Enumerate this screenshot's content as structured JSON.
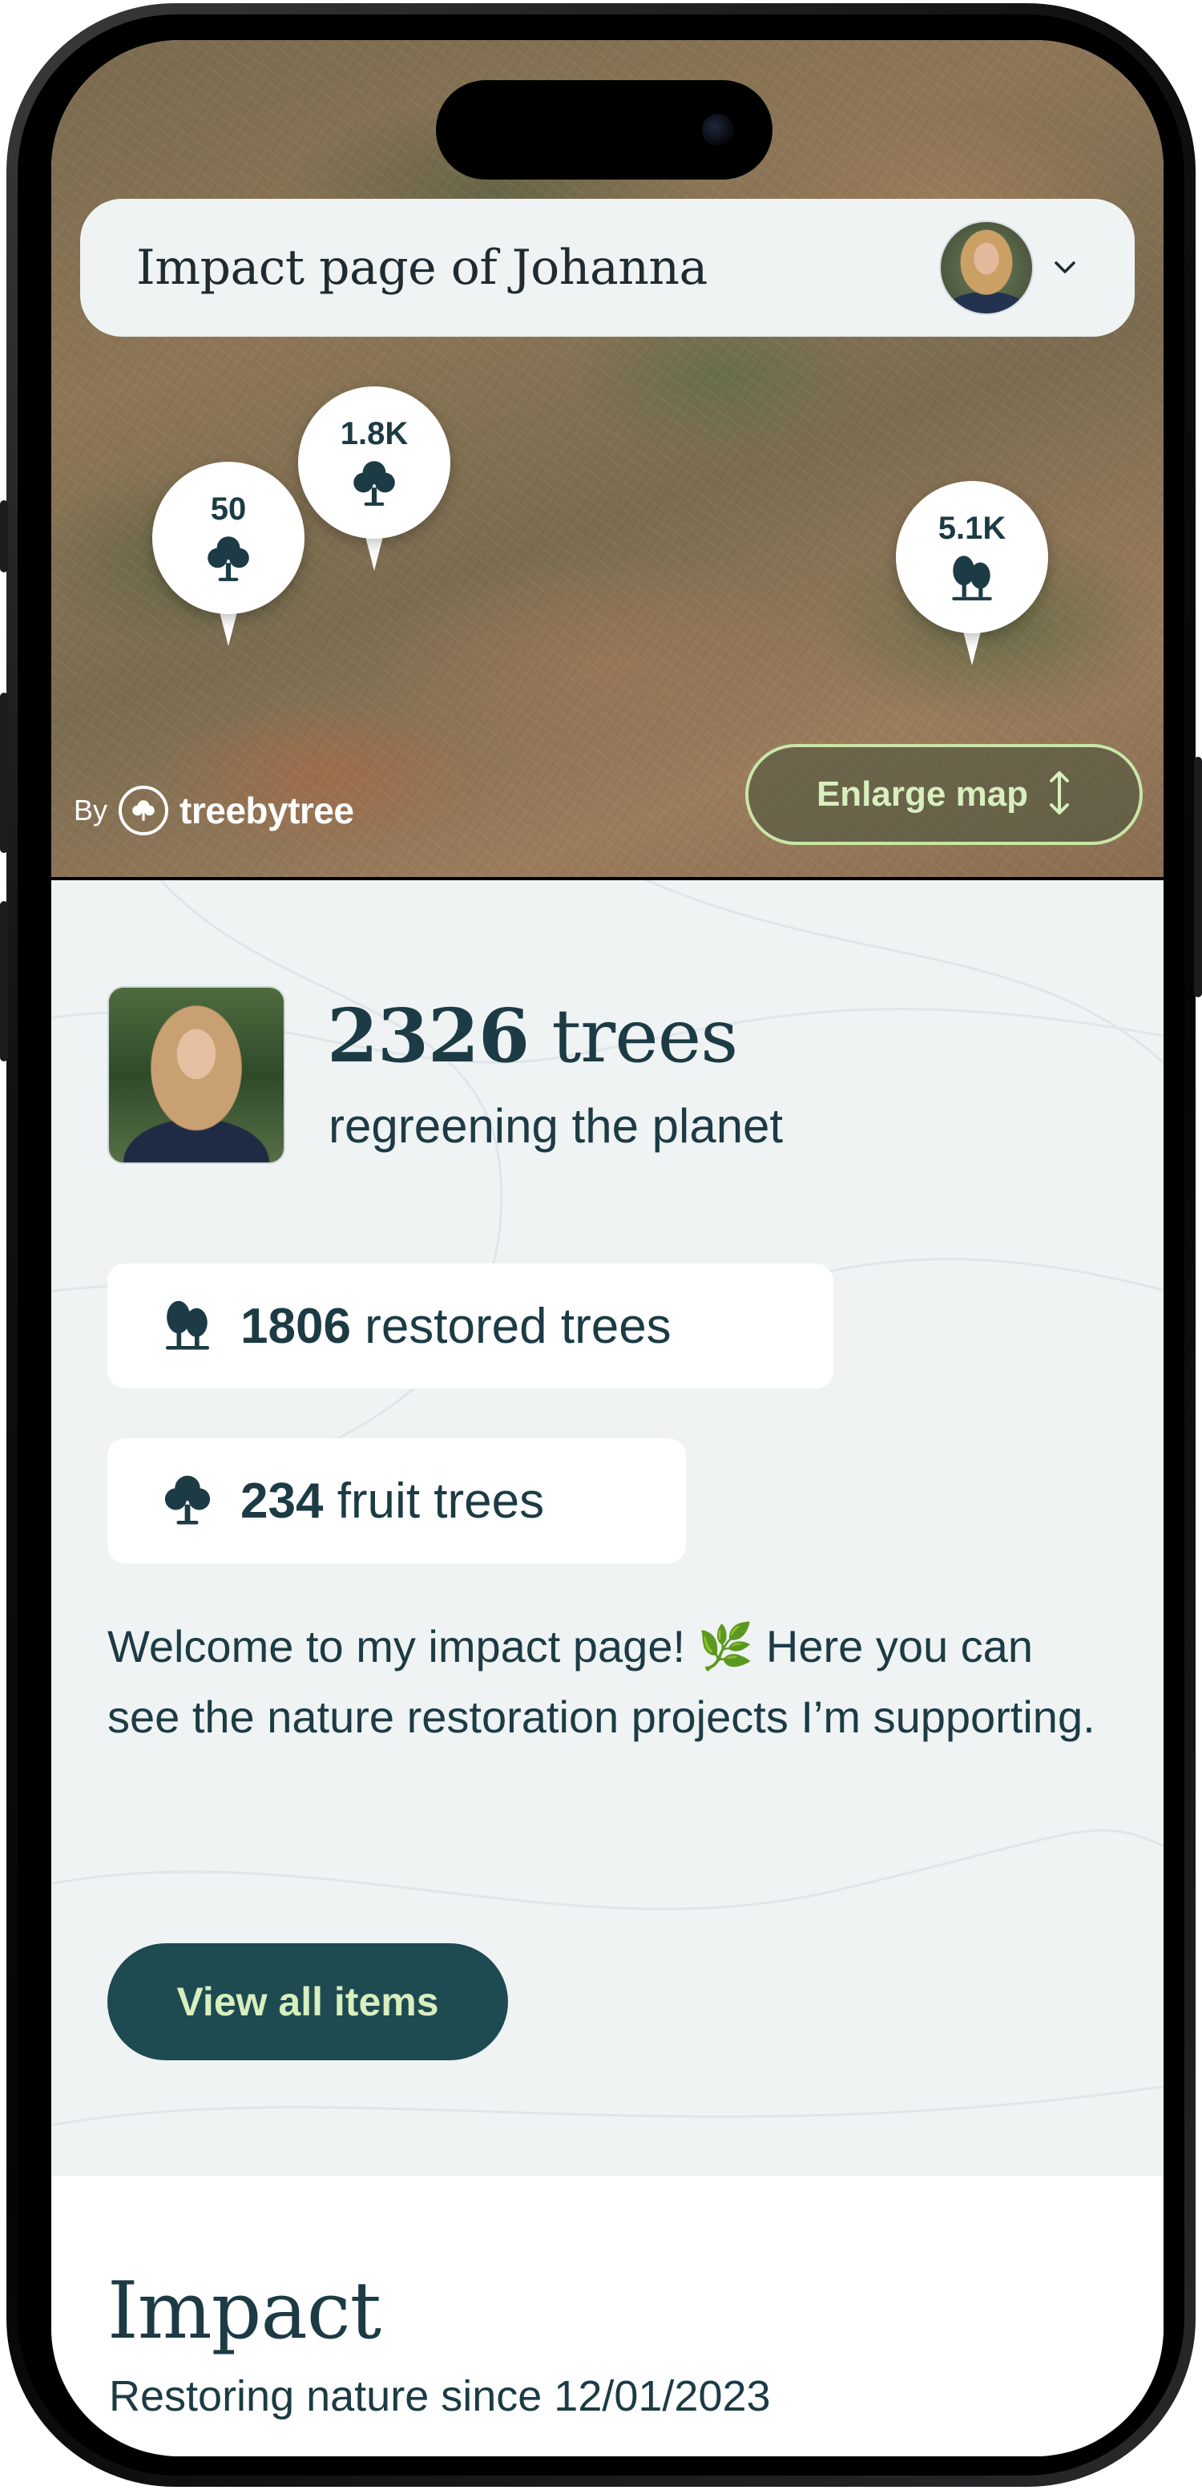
{
  "header": {
    "title": "Impact page of Johanna",
    "avatar_icon": "user-avatar",
    "menu_icon": "chevron-down-icon"
  },
  "map": {
    "pins": [
      {
        "count": "50",
        "icon": "tree-icon"
      },
      {
        "count": "1.8K",
        "icon": "tree-icon"
      },
      {
        "count": "5.1K",
        "icon": "trees-icon"
      }
    ],
    "brand_by": "By",
    "brand_name": "treebytree",
    "enlarge_label": "Enlarge map"
  },
  "summary": {
    "total_trees": "2326",
    "trees_word": "trees",
    "subtitle": "regreening the planet"
  },
  "stats": [
    {
      "number": "1806",
      "label": "restored trees",
      "icon": "trees-icon"
    },
    {
      "number": "234",
      "label": "fruit trees",
      "icon": "tree-icon"
    }
  ],
  "welcome": {
    "part1": "Welcome to my impact page! ",
    "emoji": "🌿",
    "part2": " Here you can see the nature restoration projects I’m supporting."
  },
  "view_all_label": "View all items",
  "impact": {
    "title": "Impact",
    "subtitle": "Restoring nature since 12/01/2023"
  },
  "colors": {
    "primary": "#1c3b44",
    "button_bg": "#1e4a52",
    "accent_green": "#d8efbe",
    "panel_bg": "#eff3f4"
  }
}
